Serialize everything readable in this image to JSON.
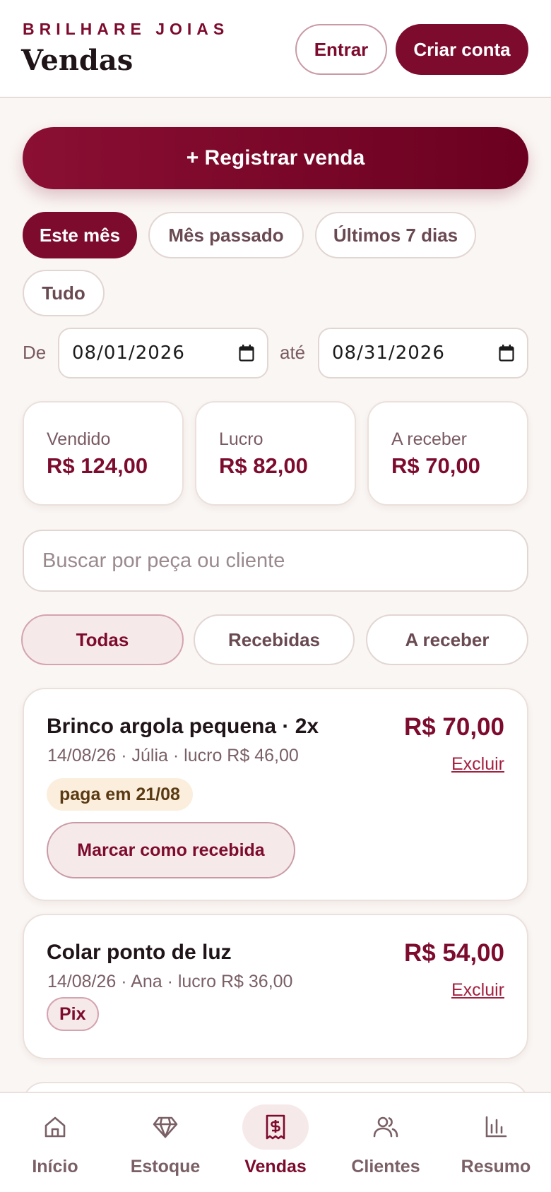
{
  "header": {
    "brand": "BRILHARE JOIAS",
    "title": "Vendas",
    "login_label": "Entrar",
    "signup_label": "Criar conta"
  },
  "actions": {
    "register_sale": "+ Registrar venda"
  },
  "period_chips": [
    {
      "label": "Este mês",
      "active": true
    },
    {
      "label": "Mês passado",
      "active": false
    },
    {
      "label": "Últimos 7 dias",
      "active": false
    },
    {
      "label": "Tudo",
      "active": false
    }
  ],
  "date_range": {
    "from_label": "De",
    "from_value": "08/01/2026",
    "to_label": "até",
    "to_value": "08/31/2026"
  },
  "stats": [
    {
      "label": "Vendido",
      "value": "R$ 124,00"
    },
    {
      "label": "Lucro",
      "value": "R$ 82,00"
    },
    {
      "label": "A receber",
      "value": "R$ 70,00"
    }
  ],
  "search": {
    "placeholder": "Buscar por peça ou cliente"
  },
  "status_filters": [
    {
      "label": "Todas",
      "active": true
    },
    {
      "label": "Recebidas",
      "active": false
    },
    {
      "label": "A receber",
      "active": false
    }
  ],
  "sales": [
    {
      "title": "Brinco argola pequena · 2x",
      "meta": "14/08/26 · Júlia · lucro R$ 46,00",
      "price": "R$ 70,00",
      "delete_label": "Excluir",
      "badge": "paga em 21/08",
      "mark_received_label": "Marcar como recebida"
    },
    {
      "title": "Colar ponto de luz",
      "meta": "14/08/26 · Ana · lucro R$ 36,00",
      "price": "R$ 54,00",
      "delete_label": "Excluir",
      "badge": "Pix"
    }
  ],
  "bottom_nav": [
    {
      "label": "Início",
      "icon": "home-icon",
      "active": false
    },
    {
      "label": "Estoque",
      "icon": "diamond-icon",
      "active": false
    },
    {
      "label": "Vendas",
      "icon": "receipt-icon",
      "active": true
    },
    {
      "label": "Clientes",
      "icon": "users-icon",
      "active": false
    },
    {
      "label": "Resumo",
      "icon": "bar-chart-icon",
      "active": false
    }
  ],
  "colors": {
    "brand": "#7d0b2e",
    "background": "#faf6f3",
    "pending_badge": "#fbeedd"
  }
}
